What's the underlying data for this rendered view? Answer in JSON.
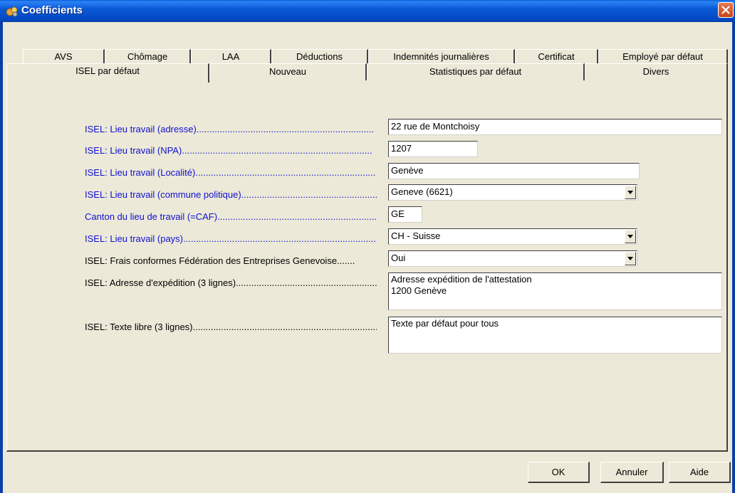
{
  "window": {
    "title": "Coefficients",
    "close_label": "✕"
  },
  "tabs": {
    "row1": [
      "AVS",
      "Chômage",
      "LAA",
      "Déductions",
      "Indemnités journalières",
      "Certificat",
      "Employé par défaut"
    ],
    "row2": [
      "ISEL par défaut",
      "Nouveau",
      "Statistiques par défaut",
      "Divers"
    ],
    "active": "ISEL par défaut"
  },
  "form": {
    "fields": [
      {
        "label": "ISEL: Lieu travail (adresse).....................................................................",
        "value": "22 rue de Montchoisy",
        "type": "text"
      },
      {
        "label": "ISEL: Lieu travail (NPA)..........................................................................",
        "value": "1207",
        "type": "text"
      },
      {
        "label": "ISEL: Lieu travail (Localité)......................................................................",
        "value": "Genève",
        "type": "text"
      },
      {
        "label": "ISEL: Lieu travail (commune politique)..........................................................",
        "value": "Geneve (6621)",
        "type": "select"
      },
      {
        "label": "Canton du lieu de travail (=CAF)..................................................................",
        "value": "GE",
        "type": "text"
      },
      {
        "label": "ISEL: Lieu travail (pays)............................................................................",
        "value": "CH - Suisse",
        "type": "select"
      },
      {
        "label": "ISEL: Frais conformes Fédération des Entreprises Genevoise.......",
        "value": "Oui",
        "type": "select"
      },
      {
        "label": "ISEL: Adresse d'expédition (3 lignes)..............................................................",
        "value": "Adresse expédition de l'attestation\n1200 Genève",
        "type": "textarea"
      },
      {
        "label": "ISEL: Texte libre (3 lignes)........................................................................",
        "value": "Texte par défaut pour tous",
        "type": "textarea"
      }
    ]
  },
  "buttons": {
    "ok": "OK",
    "cancel": "Annuler",
    "help": "Aide"
  },
  "colors": {
    "label_blue": "#1010d0",
    "title_bar": "#0a58d6"
  },
  "icons": {
    "app": "coefficients-app-icon",
    "close": "close-icon",
    "dropdown": "chevron-down-icon"
  }
}
